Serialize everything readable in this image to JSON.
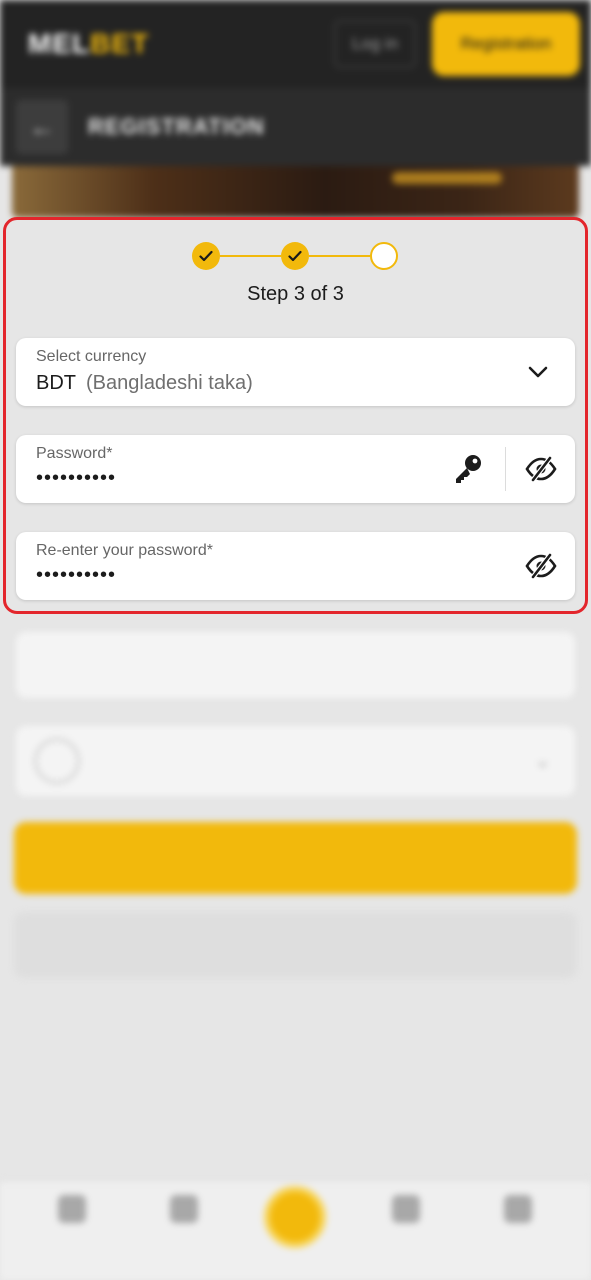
{
  "header": {
    "logo_part1": "MEL",
    "logo_part2": "BET",
    "login_label": "Log in",
    "registration_label": "Registration"
  },
  "subheader": {
    "back_symbol": "←",
    "title": "REGISTRATION"
  },
  "stepper": {
    "step_text": "Step 3 of 3",
    "steps": [
      "done",
      "done",
      "current"
    ]
  },
  "form": {
    "currency": {
      "label": "Select currency",
      "code": "BDT",
      "name": "(Bangladeshi taka)"
    },
    "password": {
      "label": "Password*",
      "value": "••••••••••"
    },
    "reenter_password": {
      "label": "Re-enter your password*",
      "value": "••••••••••"
    }
  },
  "icons": {
    "dropdown": "chevron-down-icon",
    "generate_password": "key-icon",
    "toggle_visibility": "eye-slash-icon"
  },
  "colors": {
    "accent": "#f2b90c",
    "highlight_border": "#e3262c",
    "header_bg": "#232323",
    "page_bg": "#e6e6e6"
  }
}
